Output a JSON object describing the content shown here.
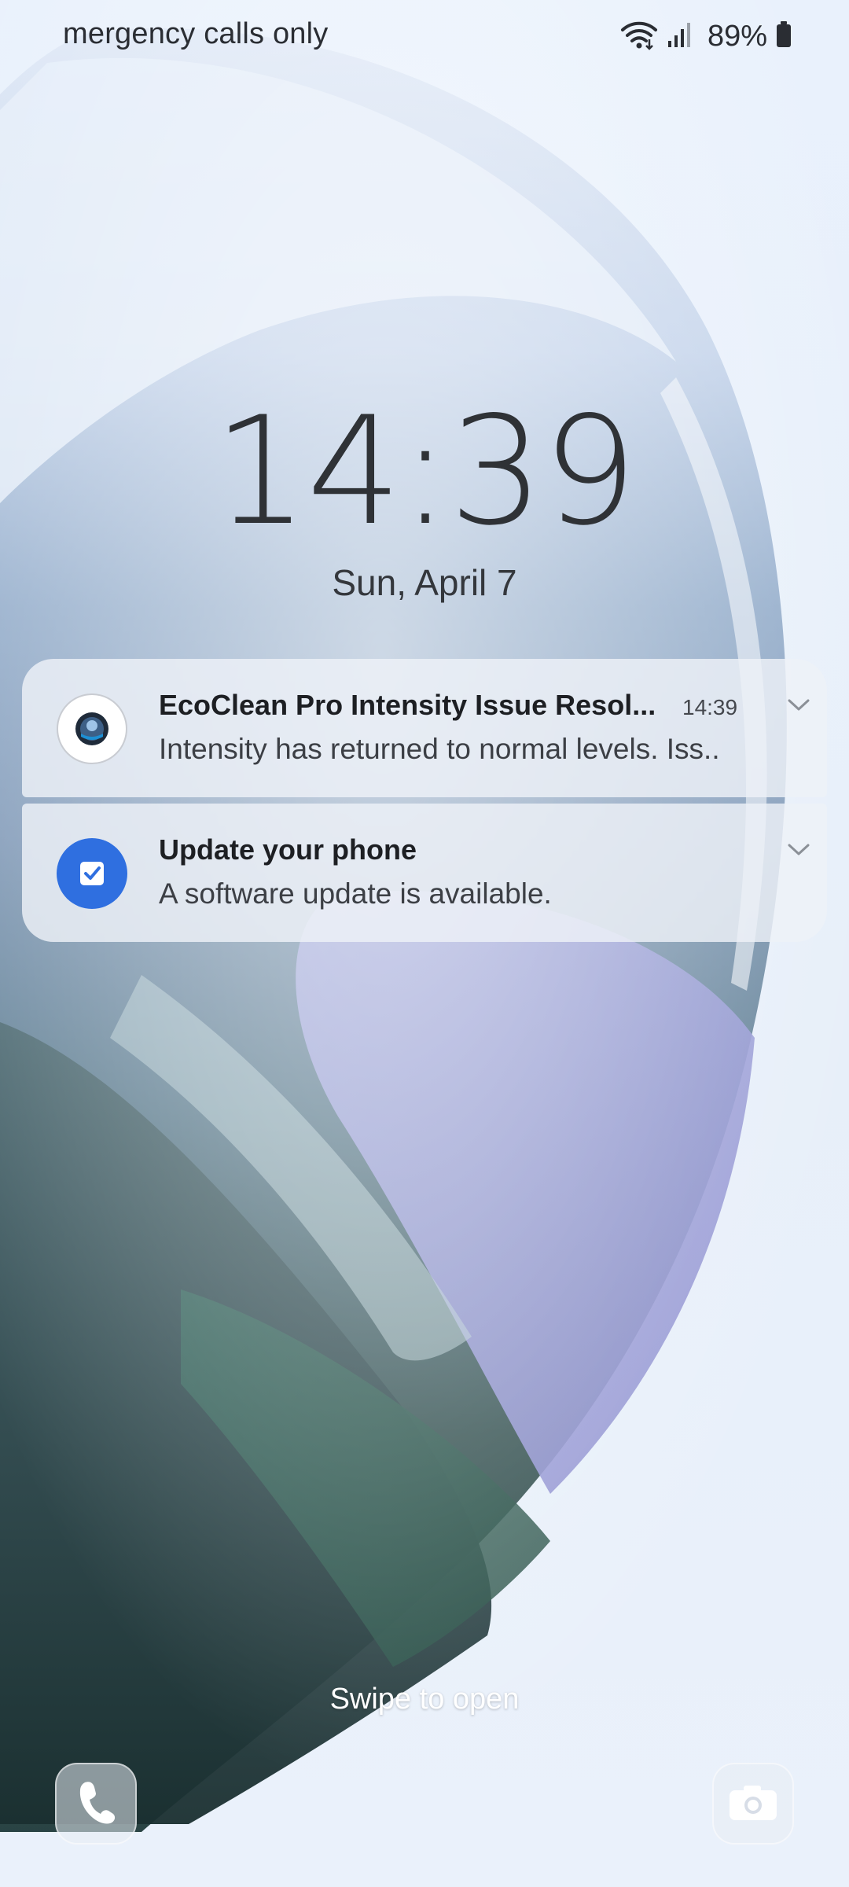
{
  "status_bar": {
    "carrier_text": "mergency calls only",
    "battery_percent": "89%",
    "icons": [
      "wifi-icon",
      "signal-icon",
      "battery-icon"
    ]
  },
  "lock_screen": {
    "time": "14:39",
    "date": "Sun, April 7"
  },
  "notifications": [
    {
      "icon": "ecoclean-app-icon",
      "title": "EcoClean Pro Intensity Issue Resol...",
      "time": "14:39",
      "body": "Intensity has returned to normal levels. Iss.."
    },
    {
      "icon": "software-update-icon",
      "title": "Update your phone",
      "body": "A software update is available."
    }
  ],
  "bottom": {
    "swipe_hint": "Swipe to open",
    "left_shortcut_icon": "phone-icon",
    "right_shortcut_icon": "camera-icon"
  },
  "colors": {
    "update_icon_bg": "#2f6fe0",
    "background": "#eaf1fb"
  }
}
